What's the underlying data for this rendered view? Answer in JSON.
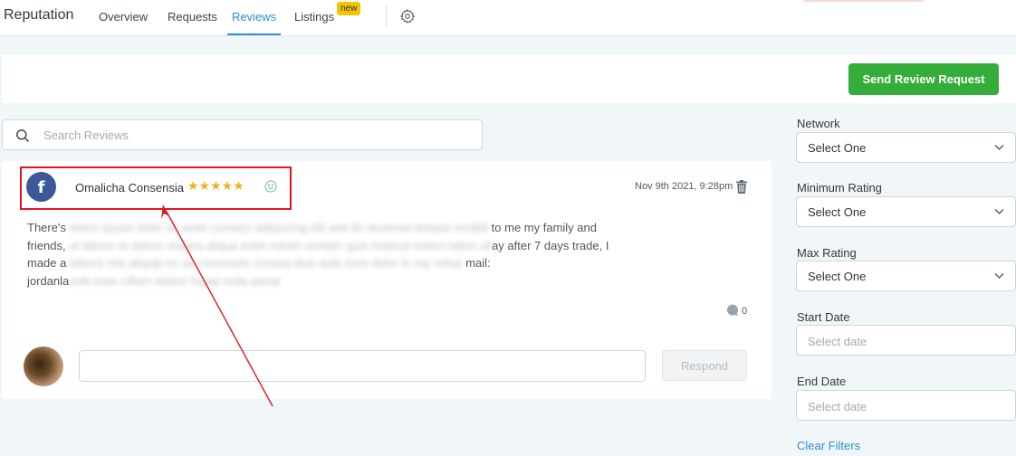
{
  "nav": {
    "brand": "Reputation",
    "tabs": [
      "Overview",
      "Requests",
      "Reviews",
      "Listings"
    ],
    "active_tab": "Reviews",
    "listings_badge": "new",
    "settings_icon": "gear-icon"
  },
  "header": {
    "send_review_request": "Send Review Request"
  },
  "search": {
    "placeholder": "Search Reviews",
    "icon": "search-icon"
  },
  "review": {
    "network_icon": "facebook-icon",
    "reviewer": "Omalicha Consensia",
    "stars": "★★★★★",
    "rating": 5,
    "sentiment_icon": "smiley-icon",
    "date": "Nov 9th 2021, 9:28pm",
    "text_visible": {
      "l1_start": "There's",
      "l1_end": "to me my family and",
      "l2_start": "friends,",
      "l2_end": "ay after 7 days trade, I",
      "l3_start": "made a",
      "l3_end": "mail:",
      "l4_start": "jordanla"
    },
    "comment_count": "0",
    "respond_label": "Respond"
  },
  "filters": {
    "network": {
      "label": "Network",
      "value": "Select One"
    },
    "min_rating": {
      "label": "Minimum Rating",
      "value": "Select One"
    },
    "max_rating": {
      "label": "Max Rating",
      "value": "Select One"
    },
    "start_date": {
      "label": "Start Date",
      "placeholder": "Select date"
    },
    "end_date": {
      "label": "End Date",
      "placeholder": "Select date"
    },
    "clear": "Clear Filters"
  },
  "colors": {
    "accent": "#2b8ed6",
    "primary_button": "#35ad3a",
    "stars": "#f2b01e",
    "highlight": "#e0161e",
    "facebook": "#3b5998"
  }
}
